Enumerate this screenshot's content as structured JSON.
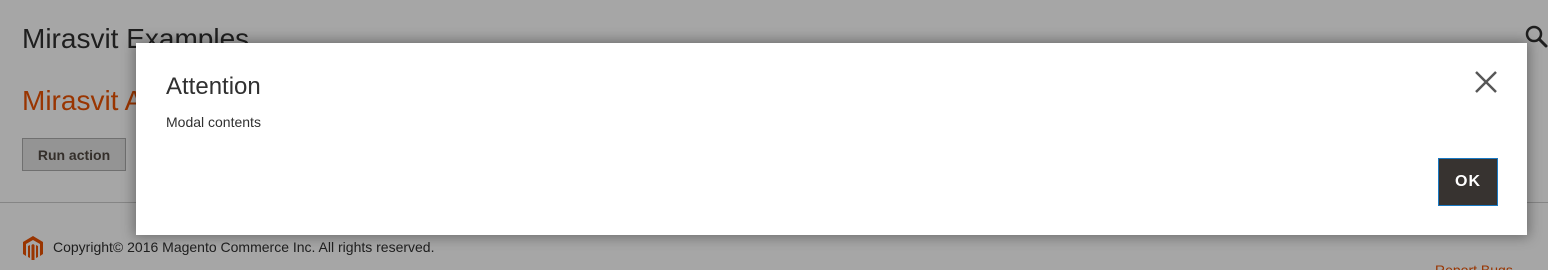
{
  "page": {
    "title": "Mirasvit Examples",
    "subtitle": "Mirasvit A",
    "run_action_label": "Run action"
  },
  "footer": {
    "copyright": "Copyright© 2016 Magento Commerce Inc. All rights reserved.",
    "report_bugs": "Report Bugs"
  },
  "modal": {
    "title": "Attention",
    "content": "Modal contents",
    "ok_label": "OK"
  },
  "colors": {
    "accent": "#eb5202",
    "ok_button_bg": "#373330",
    "ok_button_border": "#1979c3",
    "overlay": "rgba(0,0,0,0.35)"
  },
  "icons": {
    "search": "search-icon",
    "close": "close-icon",
    "logo": "magento-logo-icon"
  }
}
